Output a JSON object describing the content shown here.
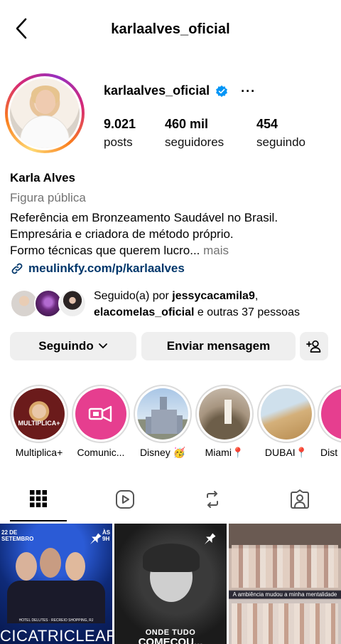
{
  "header": {
    "title": "karlaalves_oficial"
  },
  "profile": {
    "handle": "karlaalves_oficial",
    "more": "···",
    "stats": [
      {
        "num": "9.021",
        "label": "posts"
      },
      {
        "num": "460 mil",
        "label": "seguidores"
      },
      {
        "num": "454",
        "label": "seguindo"
      }
    ],
    "name": "Karla Alves",
    "category": "Figura pública",
    "bio": [
      "Referência em Bronzeamento Saudável no Brasil.",
      "Empresária e criadora de método próprio.",
      "Formo técnicas que querem lucro..."
    ],
    "bio_more": "mais",
    "link": "meulinkfy.com/p/karlaalves"
  },
  "followed_by": {
    "prefix": "Seguido(a) por ",
    "user1": "jessycacamila9",
    "sep": ",",
    "user2": "elacomelas_oficial",
    "suffix": " e outras 37 pessoas"
  },
  "actions": {
    "following": "Seguindo",
    "message": "Enviar mensagem"
  },
  "highlights": [
    {
      "label": "Multiplica+"
    },
    {
      "label": "Comunic..."
    },
    {
      "label": "Disney 🥳"
    },
    {
      "label": "Miami📍"
    },
    {
      "label": "DUBAI📍"
    },
    {
      "label": "Dist"
    }
  ],
  "highlight_texts": {
    "multiplica": "MULTIPLICA+"
  },
  "posts": [
    {
      "top_left": "22 DE SETEMBRO",
      "top_right": "ÀS 9H",
      "small": "HOTEL DELUTES · RECREIO SHOPPING, RJ",
      "caption": "CICATRICLEAR"
    },
    {
      "caption1": "ONDE TUDO",
      "caption2": "COMEÇOU..."
    },
    {
      "caption": "A ambiência mudou a minha mentalidade"
    }
  ],
  "colors": {
    "link": "#00376b",
    "verified": "#0095f6",
    "muted": "#737373",
    "button_bg": "#efefef",
    "story_pink": "#e63e8f"
  }
}
